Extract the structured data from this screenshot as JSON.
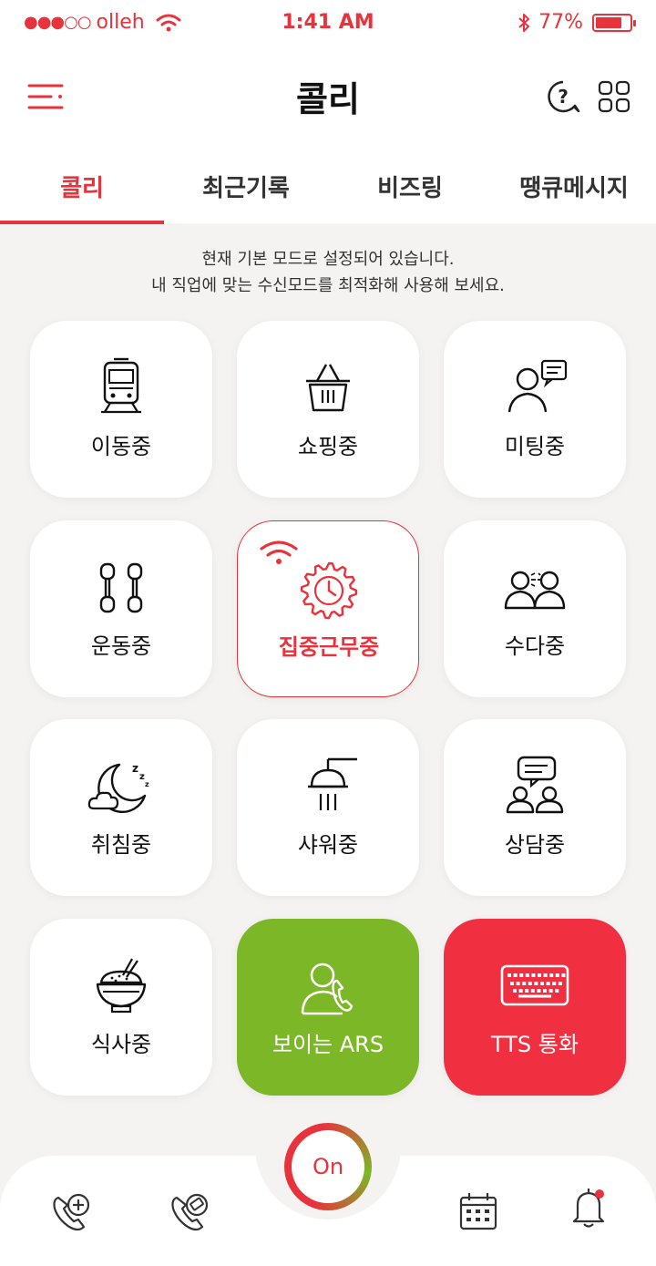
{
  "status_bar": {
    "signal_dots": "●●●○○",
    "carrier": "olleh",
    "time": "1:41 AM",
    "battery": "77%",
    "battery_level": 0.77
  },
  "header": {
    "title": "콜리"
  },
  "tabs": [
    {
      "label": "콜리",
      "active": true
    },
    {
      "label": "최근기록",
      "active": false
    },
    {
      "label": "비즈링",
      "active": false
    },
    {
      "label": "땡큐메시지",
      "active": false
    }
  ],
  "notice": {
    "line1": "현재 기본 모드로 설정되어 있습니다.",
    "line2": "내 직업에 맞는 수신모드를 최적화해 사용해 보세요."
  },
  "modes": [
    {
      "label": "이동중",
      "icon": "train-icon"
    },
    {
      "label": "쇼핑중",
      "icon": "basket-icon"
    },
    {
      "label": "미팅중",
      "icon": "meeting-icon"
    },
    {
      "label": "운동중",
      "icon": "dumbbell-icon"
    },
    {
      "label": "집중근무중",
      "icon": "gear-clock-icon",
      "active": true
    },
    {
      "label": "수다중",
      "icon": "chat-people-icon"
    },
    {
      "label": "취침중",
      "icon": "moon-sleep-icon"
    },
    {
      "label": "샤워중",
      "icon": "shower-icon"
    },
    {
      "label": "상담중",
      "icon": "consult-icon"
    },
    {
      "label": "식사중",
      "icon": "rice-bowl-icon"
    },
    {
      "label": "보이는 ARS",
      "icon": "ars-phone-icon"
    },
    {
      "label": "TTS 통화",
      "icon": "keyboard-icon"
    }
  ],
  "bottom_bar": {
    "on_label": "On"
  },
  "colors": {
    "accent": "#e8323c",
    "green": "#7cb728",
    "red_card": "#f03040",
    "background": "#f4f3f1"
  }
}
